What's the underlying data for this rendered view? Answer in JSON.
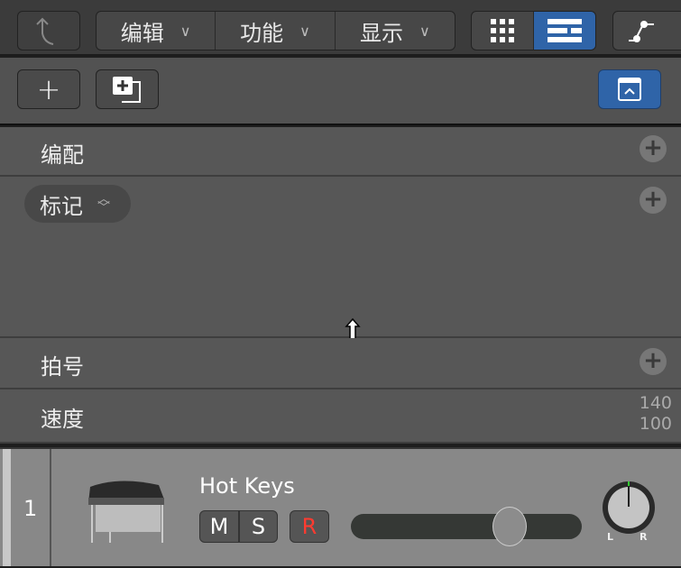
{
  "toolbar": {
    "menus": [
      {
        "label": "编辑"
      },
      {
        "label": "功能"
      },
      {
        "label": "显示"
      }
    ],
    "chevron": "∨",
    "accent": "#2f64a8"
  },
  "rows": {
    "arrangement": "编配",
    "marker": "标记",
    "signature": "拍号",
    "tempo": "速度",
    "tempo_values": [
      "140",
      "100"
    ]
  },
  "track": {
    "number": "1",
    "name": "Hot Keys",
    "mute": "M",
    "solo": "S",
    "record": "R",
    "volume_fraction": 0.72,
    "pan": 0,
    "pan_left": "L",
    "pan_right": "R"
  }
}
